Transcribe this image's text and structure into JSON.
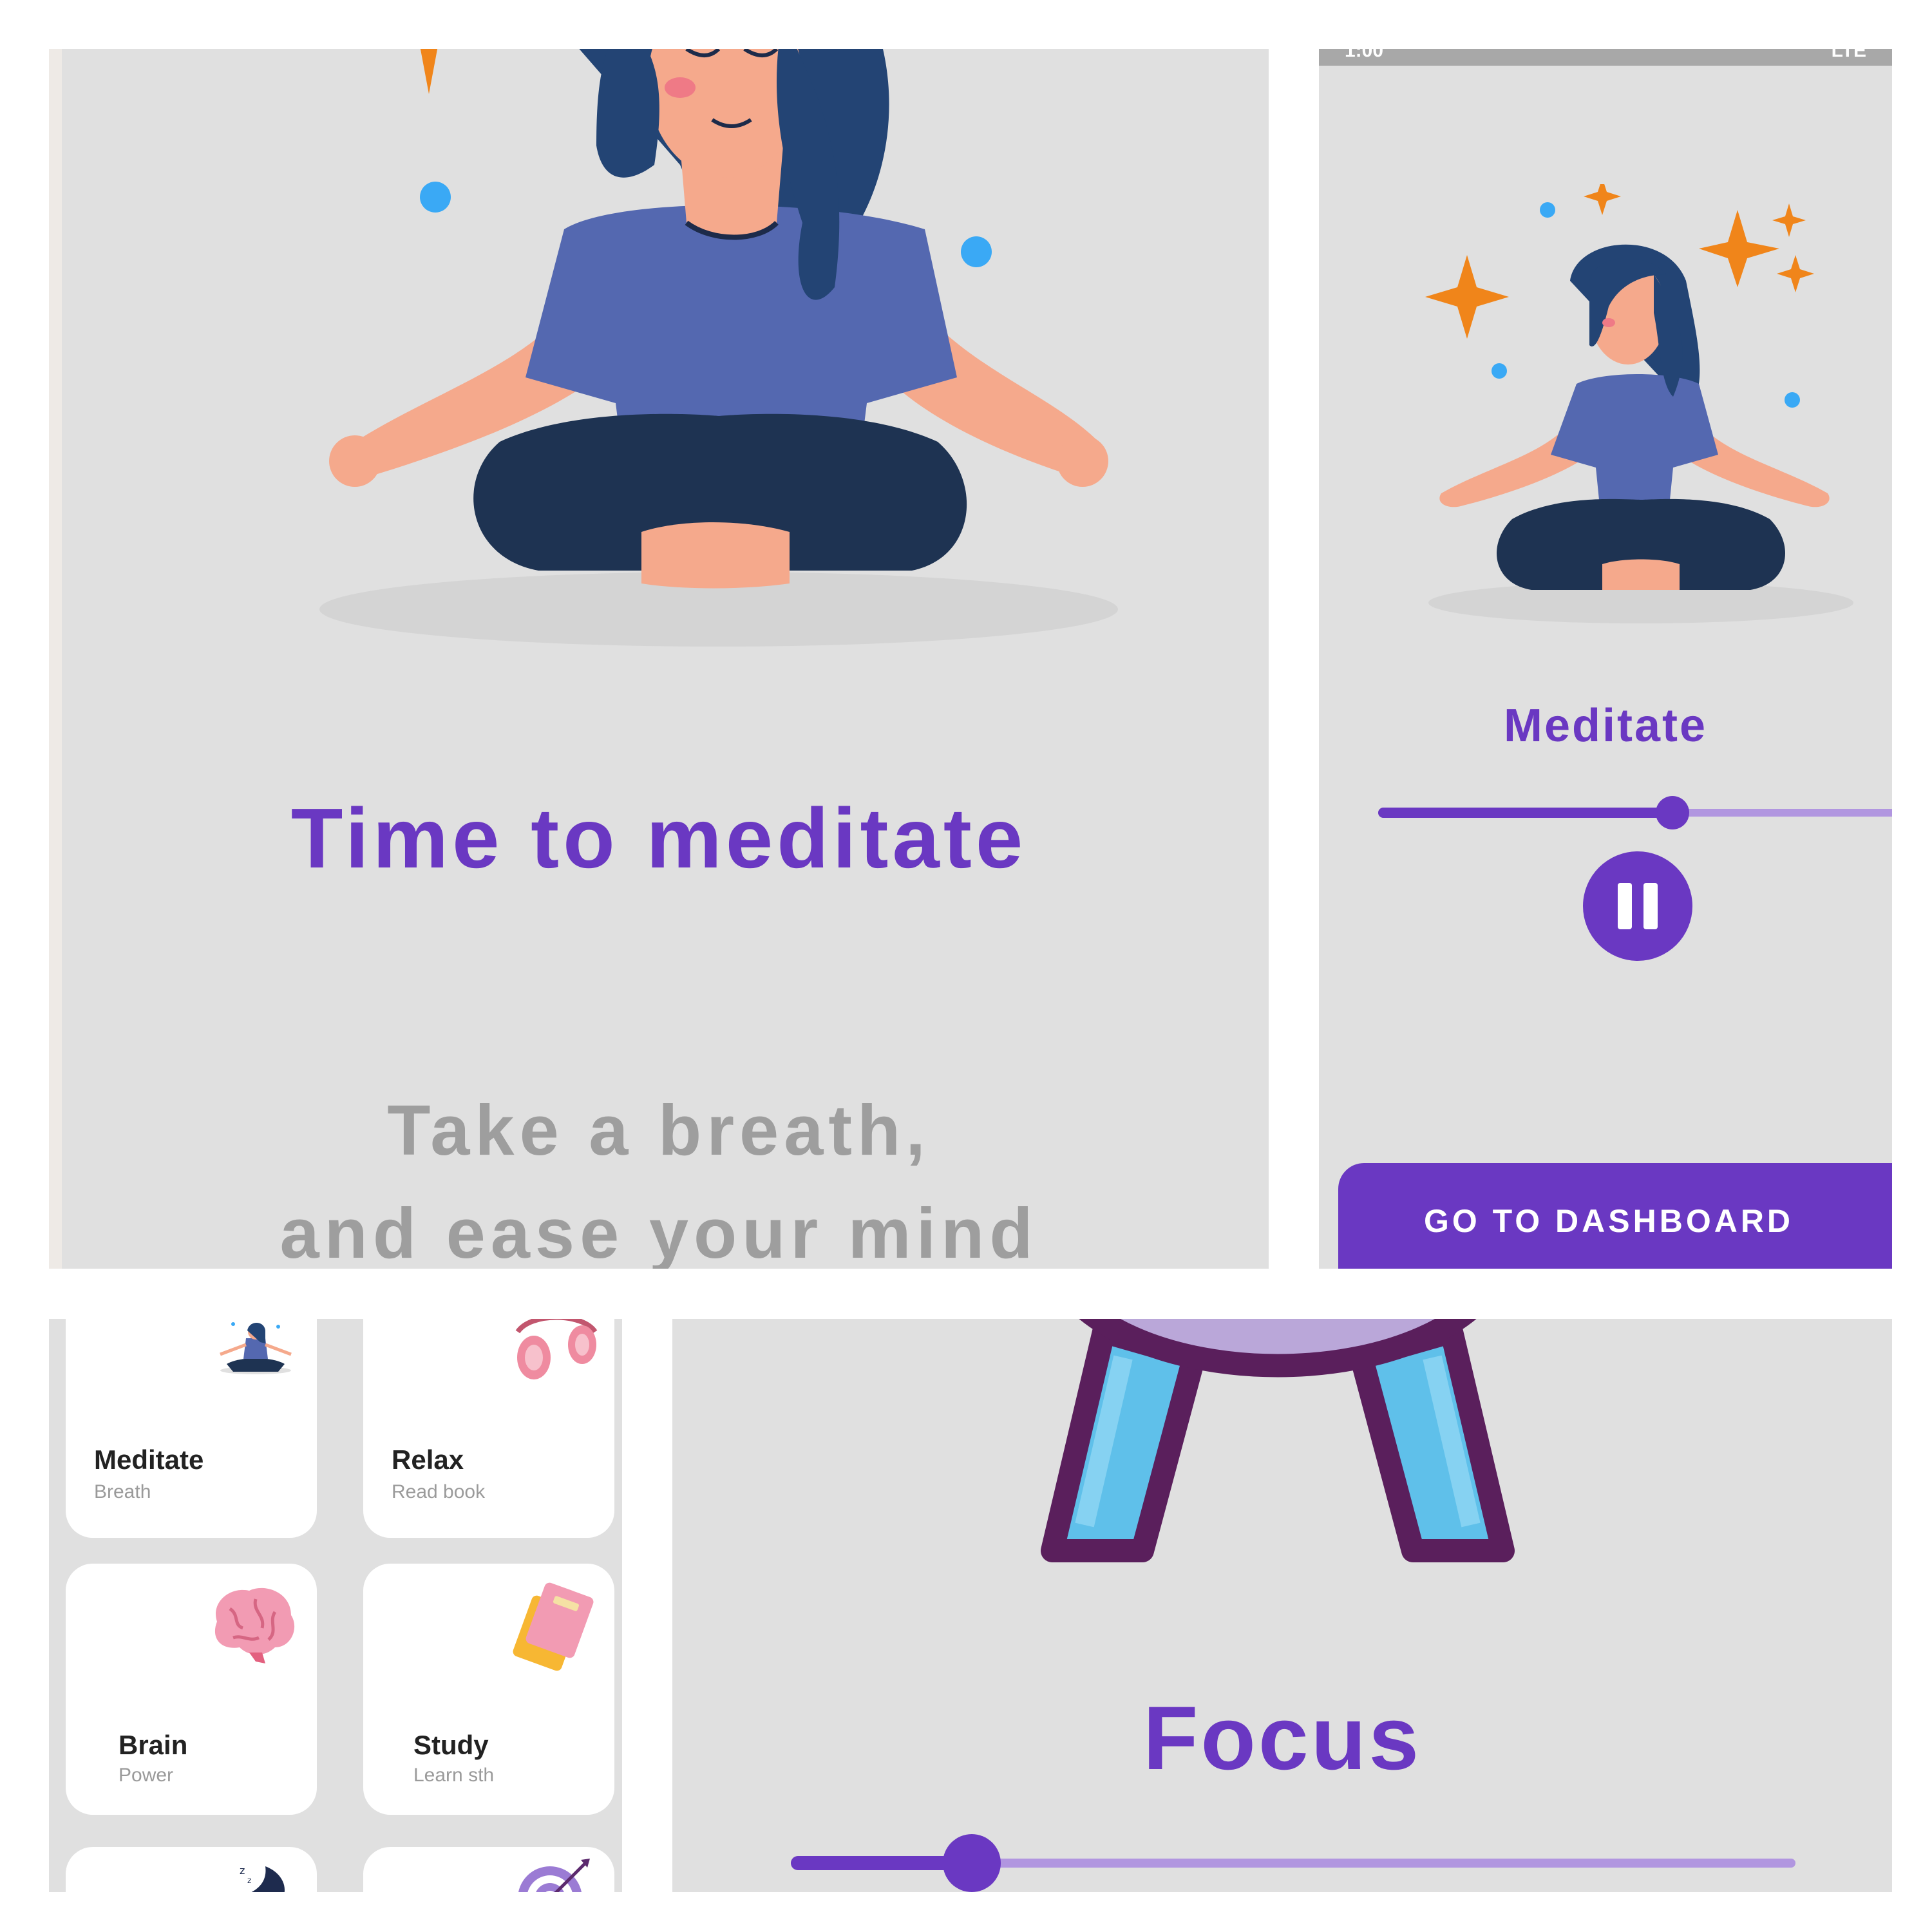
{
  "meditate_intro": {
    "title": "Time to meditate",
    "subtitle_line1": "Take a breath,",
    "subtitle_line2": "and ease your mind"
  },
  "player": {
    "status_time": "1:00",
    "status_network": "LTE",
    "label": "Meditate",
    "progress": 0.55,
    "dashboard_button": "GO TO DASHBOARD"
  },
  "dashboard": {
    "cards": [
      {
        "title": "Meditate",
        "subtitle": "Breath",
        "icon": "meditation-icon"
      },
      {
        "title": "Relax",
        "subtitle": "Read book",
        "icon": "headphones-icon"
      },
      {
        "title": "Brain",
        "subtitle": "Power",
        "icon": "brain-icon"
      },
      {
        "title": "Study",
        "subtitle": "Learn sth",
        "icon": "notebook-icon"
      },
      {
        "title": "",
        "subtitle": "",
        "icon": "moon-sleep-icon"
      },
      {
        "title": "",
        "subtitle": "",
        "icon": "target-icon"
      }
    ]
  },
  "focus": {
    "label": "Focus",
    "progress": 0.18
  },
  "colors": {
    "accent": "#6a38c2",
    "track": "#b196e0",
    "background": "#e0e0e0"
  }
}
